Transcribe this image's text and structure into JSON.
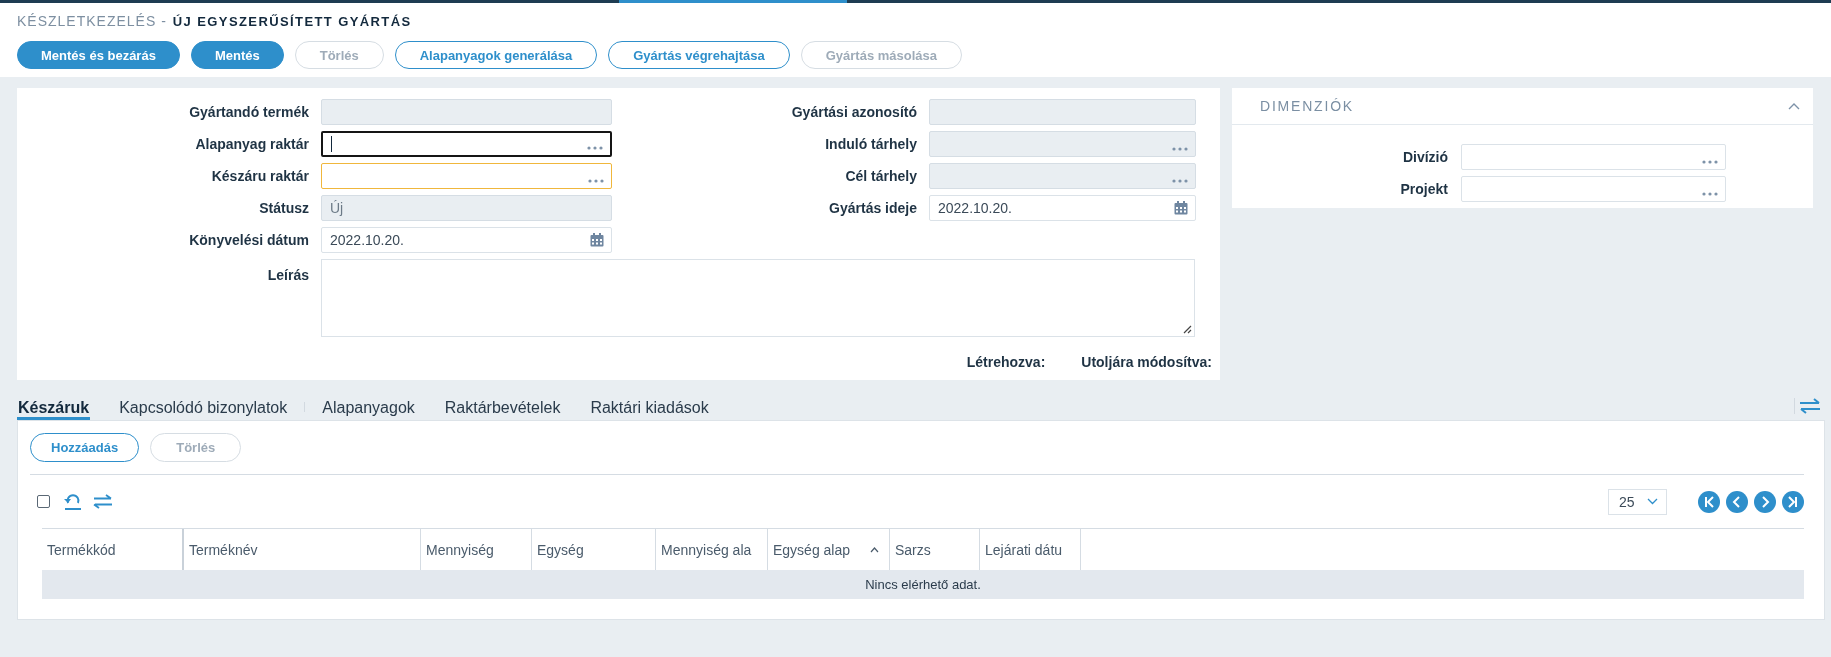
{
  "header": {
    "module": "KÉSZLETKEZELÉS -",
    "title": "ÚJ EGYSZERŰSÍTETT GYÁRTÁS"
  },
  "actions": [
    {
      "label": "Mentés és bezárás",
      "kind": "primary",
      "disabled": false
    },
    {
      "label": "Mentés",
      "kind": "primary",
      "disabled": false
    },
    {
      "label": "Törlés",
      "kind": "outline",
      "disabled": true
    },
    {
      "label": "Alapanyagok generálása",
      "kind": "outline",
      "disabled": false
    },
    {
      "label": "Gyártás végrehajtása",
      "kind": "outline",
      "disabled": false
    },
    {
      "label": "Gyártás másolása",
      "kind": "outline",
      "disabled": true
    }
  ],
  "form": {
    "left_fields": [
      {
        "label": "Gyártandó termék",
        "kind": "text",
        "disabled": true,
        "focused": false,
        "invalid": false
      },
      {
        "label": "Alapanyag raktár",
        "kind": "lookup",
        "disabled": false,
        "focused": true,
        "invalid": false
      },
      {
        "label": "Készáru raktár",
        "kind": "lookup",
        "disabled": false,
        "focused": false,
        "invalid": true
      },
      {
        "label": "Státusz",
        "kind": "text",
        "value": "Új",
        "disabled": true,
        "focused": false,
        "invalid": false
      },
      {
        "label": "Könyvelési dátum",
        "kind": "date",
        "value": "2022.10.20.",
        "disabled": false,
        "focused": false,
        "invalid": false
      }
    ],
    "right_fields": [
      {
        "label": "Gyártási azonosító",
        "kind": "text",
        "disabled": true,
        "focused": false,
        "invalid": false
      },
      {
        "label": "Induló tárhely",
        "kind": "lookup",
        "disabled": true,
        "focused": false,
        "invalid": false
      },
      {
        "label": "Cél tárhely",
        "kind": "lookup",
        "disabled": true,
        "focused": false,
        "invalid": false
      },
      {
        "label": "Gyártás ideje",
        "kind": "date",
        "value": "2022.10.20.",
        "disabled": false,
        "focused": false,
        "invalid": false
      }
    ],
    "description": {
      "label": "Leírás"
    },
    "audit": [
      "Létrehozva:",
      "Utoljára módosítva:"
    ]
  },
  "dimensions": {
    "title": "DIMENZIÓK",
    "expanded": true,
    "fields": [
      {
        "label": "Divízió",
        "kind": "lookup",
        "disabled": false,
        "focused": false,
        "invalid": false
      },
      {
        "label": "Projekt",
        "kind": "lookup",
        "disabled": false,
        "focused": false,
        "invalid": false
      }
    ]
  },
  "tab_groups": [
    {
      "tabs": [
        {
          "label": "Készáruk",
          "selected": true
        },
        {
          "label": "Kapcsolódó bizonylatok",
          "selected": false
        }
      ]
    },
    {
      "tabs": [
        {
          "label": "Alapanyagok",
          "selected": false
        },
        {
          "label": "Raktárbevételek",
          "selected": false
        },
        {
          "label": "Raktári kiadások",
          "selected": false
        }
      ]
    }
  ],
  "grid": {
    "buttons": [
      {
        "label": "Hozzáadás",
        "disabled": false
      },
      {
        "label": "Törlés",
        "disabled": true
      }
    ],
    "select_all": {
      "checked": false
    },
    "page_size": "25",
    "columns": [
      {
        "label": "Termékkód",
        "sorted": false
      },
      {
        "label": "Terméknév",
        "sorted": false
      },
      {
        "label": "Mennyiség",
        "sorted": false
      },
      {
        "label": "Egység",
        "sorted": false
      },
      {
        "label": "Mennyiség ala",
        "sorted": false
      },
      {
        "label": "Egység alap",
        "sorted": true
      },
      {
        "label": "Sarzs",
        "sorted": false
      },
      {
        "label": "Lejárati dátu",
        "sorted": false
      }
    ],
    "empty_message": "Nincs elérhető adat."
  }
}
